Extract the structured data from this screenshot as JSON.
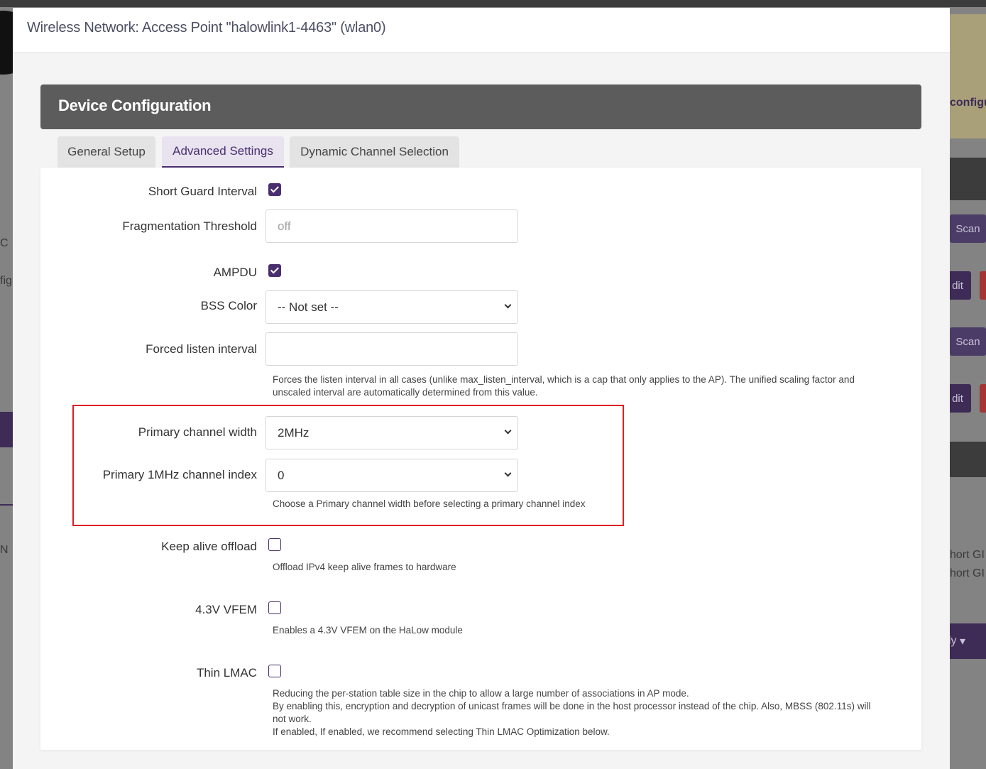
{
  "background": {
    "notice_text": "configu",
    "scan_label": "Scan",
    "edit_label": "dit",
    "apply_label": "ly",
    "side_text_1": "C",
    "side_text_2": "fig",
    "side_text_3": "N",
    "right_text_1": "hort GI",
    "right_text_2": "hort GI"
  },
  "modal": {
    "title": "Wireless Network: Access Point \"halowlink1-4463\" (wlan0)"
  },
  "section": {
    "title": "Device Configuration"
  },
  "tabs": [
    {
      "label": "General Setup"
    },
    {
      "label": "Advanced Settings"
    },
    {
      "label": "Dynamic Channel Selection"
    }
  ],
  "fields": {
    "short_guard_interval": {
      "label": "Short Guard Interval",
      "checked": true
    },
    "fragmentation_threshold": {
      "label": "Fragmentation Threshold",
      "placeholder": "off",
      "value": ""
    },
    "ampdu": {
      "label": "AMPDU",
      "checked": true
    },
    "bss_color": {
      "label": "BSS Color",
      "selected": "-- Not set --"
    },
    "forced_listen_interval": {
      "label": "Forced listen interval",
      "value": "",
      "help_line1": "Forces the listen interval in all cases (unlike max_listen_interval, which is a cap that only applies to the AP). The unified scaling factor and",
      "help_line2": "unscaled interval are automatically determined from this value."
    },
    "primary_channel_width": {
      "label": "Primary channel width",
      "selected": "2MHz"
    },
    "primary_1mhz_channel_index": {
      "label": "Primary 1MHz channel index",
      "selected": "0",
      "help": "Choose a Primary channel width before selecting a primary channel index"
    },
    "keep_alive_offload": {
      "label": "Keep alive offload",
      "checked": false,
      "help": "Offload IPv4 keep alive frames to hardware"
    },
    "vfem": {
      "label": "4.3V VFEM",
      "checked": false,
      "help": "Enables a 4.3V VFEM on the HaLow module"
    },
    "thin_lmac": {
      "label": "Thin LMAC",
      "checked": false,
      "help_line1": "Reducing the per-station table size in the chip to allow a large number of associations in AP mode.",
      "help_line2": "By enabling this, encryption and decryption of unicast frames will be done in the host processor instead of the chip. Also, MBSS (802.11s) will",
      "help_line3": "not work.",
      "help_line4": "If enabled, If enabled, we recommend selecting Thin LMAC Optimization below."
    }
  },
  "colors": {
    "accent": "#4a2f6e",
    "highlight_border": "#dd2020",
    "section_header": "#5c5c5c"
  }
}
